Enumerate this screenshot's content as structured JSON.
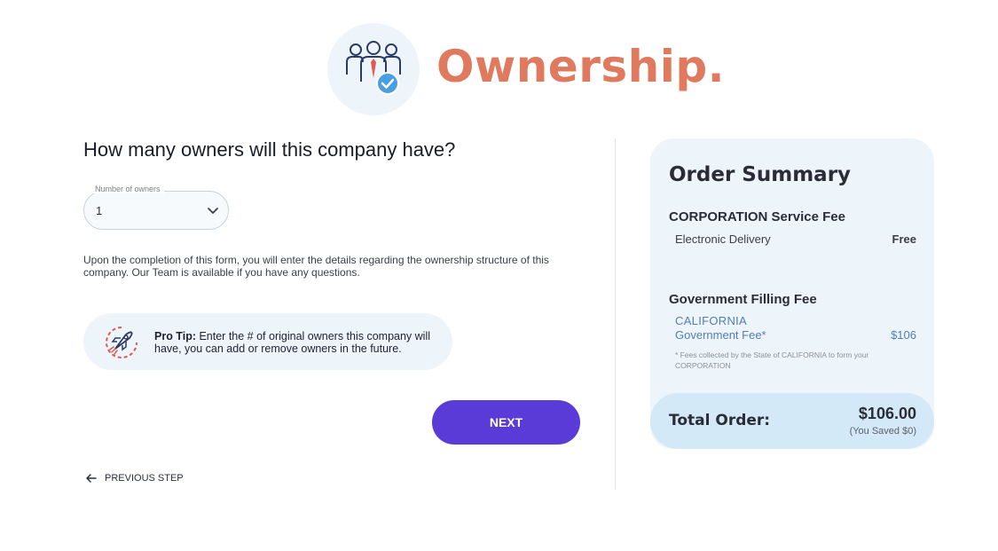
{
  "header": {
    "title": "Ownership.",
    "icon": "team-owners-check-icon"
  },
  "question": "How many owners will this company have?",
  "owners_field": {
    "label": "Number of owners",
    "value": "1"
  },
  "description": "Upon the completion of this form, you will enter the details regarding the ownership structure of this company. Our Team is available if you have any questions.",
  "tip": {
    "icon": "rocket-icon",
    "bold": "Pro Tip:",
    "text": " Enter the # of original owners this company will have, you can add or remove owners in the future."
  },
  "next_label": "NEXT",
  "previous_label": "PREVIOUS STEP",
  "summary": {
    "title": "Order Summary",
    "corp_heading": "CORPORATION Service Fee",
    "delivery_label": "Electronic Delivery",
    "delivery_value": "Free",
    "gov_heading": "Government Filling Fee",
    "gov_state": "CALIFORNIA",
    "gov_fee_label": "Government Fee*",
    "gov_fee_amount": "$106",
    "gov_note": "* Fees collected by the State of CALIFORNIA to form your CORPORATION",
    "total_label": "Total Order:",
    "total_amount": "$106.00",
    "total_saved": "(You Saved $0)"
  },
  "colors": {
    "accent": "#e07a5f",
    "primary_button": "#5a3bd8",
    "link_blue": "#4f7fb2",
    "panel_bg": "#eef5fa"
  }
}
